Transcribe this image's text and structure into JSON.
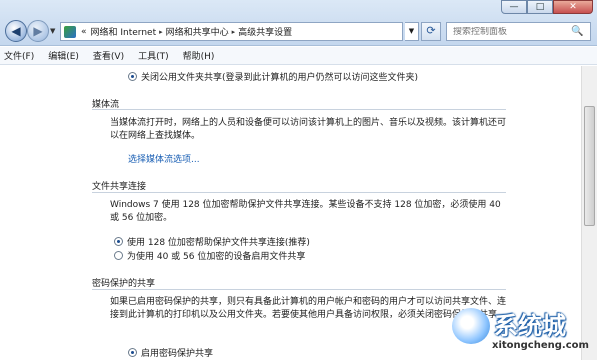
{
  "window": {
    "minimize_label": "—",
    "maximize_label": "□",
    "close_label": "✕"
  },
  "nav": {
    "back_glyph": "◀",
    "forward_glyph": "▶",
    "dropdown_glyph": "▼"
  },
  "address": {
    "overflow": "«",
    "parts": [
      "网络和 Internet",
      "网络和共享中心",
      "高级共享设置"
    ],
    "separator": "▸",
    "dropdown_glyph": "▼"
  },
  "refresh_glyph": "⟳",
  "search": {
    "placeholder": "搜索控制面板",
    "icon": "🔍"
  },
  "menu": [
    "文件(F)",
    "编辑(E)",
    "查看(V)",
    "工具(T)",
    "帮助(H)"
  ],
  "content": {
    "public_folder_off": "关闭公用文件夹共享(登录到此计算机的用户仍然可以访问这些文件夹)",
    "media_streaming": {
      "title": "媒体流",
      "description": "当媒体流打开时，网络上的人员和设备便可以访问该计算机上的图片、音乐以及视频。该计算机还可以在网络上查找媒体。",
      "link": "选择媒体流选项..."
    },
    "file_sharing": {
      "title": "文件共享连接",
      "description": "Windows 7 使用 128 位加密帮助保护文件共享连接。某些设备不支持 128 位加密，必须使用 40 或 56 位加密。",
      "option1": "使用 128 位加密帮助保护文件共享连接(推荐)",
      "option2": "为使用 40 或 56 位加密的设备启用文件共享"
    },
    "password_sharing": {
      "title": "密码保护的共享",
      "description": "如果已启用密码保护的共享，则只有具备此计算机的用户帐户和密码的用户才可以访问共享文件、连接到此计算机的打印机以及公用文件夹。若要使其他用户具备访问权限，必须关闭密码保护的共享。",
      "option1": "启用密码保护共享"
    }
  },
  "watermark": {
    "name": "系统城",
    "url": "xitongcheng.com"
  }
}
